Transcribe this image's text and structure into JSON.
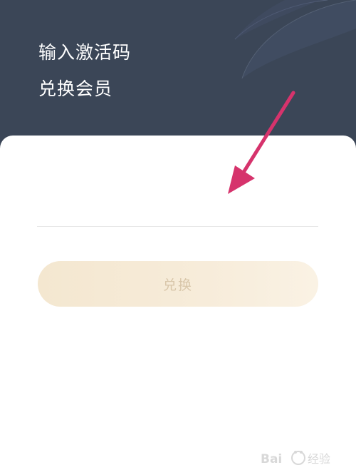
{
  "header": {
    "title_line_1": "输入激活码",
    "title_line_2": "兑换会员"
  },
  "form": {
    "code_input_value": "",
    "code_input_placeholder": "",
    "redeem_button_label": "兑换",
    "redeem_button_state": "disabled"
  },
  "overlay": {
    "annotation_arrow_color": "#d6336c"
  },
  "watermark": {
    "text": "Bai 经验"
  },
  "colors": {
    "header_bg": "#3b4657",
    "button_bg": "#f5e9d4",
    "button_text": "#d8c6a9"
  }
}
